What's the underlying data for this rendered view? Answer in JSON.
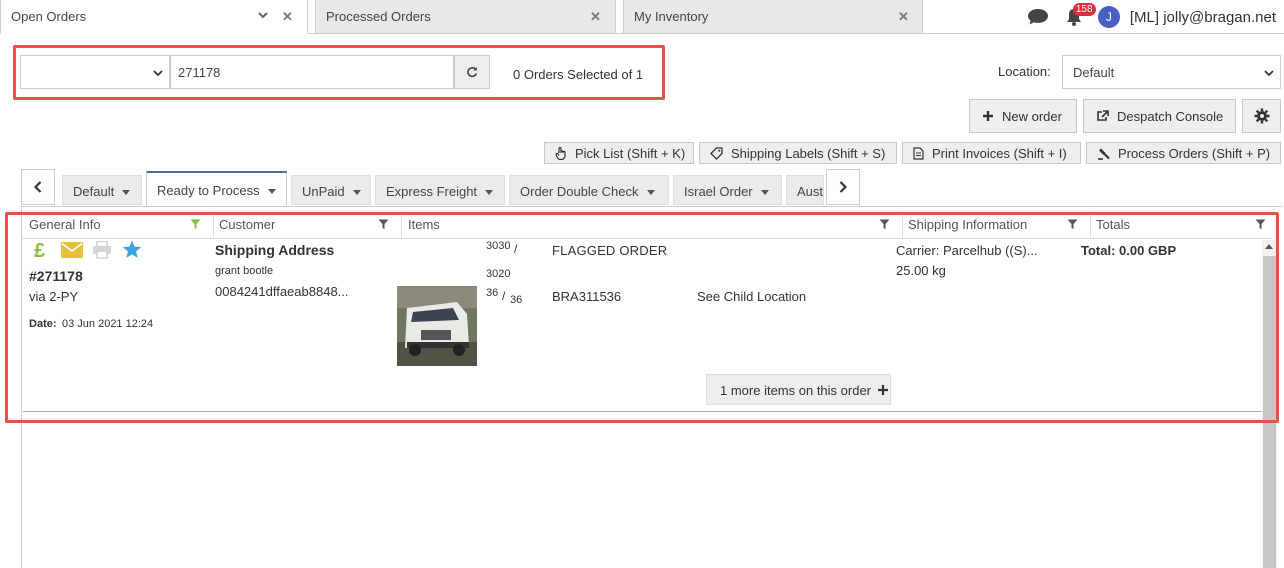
{
  "tabs": [
    {
      "label": "Open Orders",
      "active": true
    },
    {
      "label": "Processed Orders",
      "active": false
    },
    {
      "label": "My Inventory",
      "active": false
    }
  ],
  "header": {
    "notification_count": "158",
    "avatar_letter": "J",
    "user": "[ML] jolly@bragan.net"
  },
  "search": {
    "field_value": "",
    "query": "271178",
    "selected_text": "0 Orders Selected of 1"
  },
  "location": {
    "label": "Location:",
    "value": "Default"
  },
  "actions": {
    "new_order": "New order",
    "despatch_console": "Despatch Console"
  },
  "toolbar": {
    "pick_list": "Pick List (Shift + K)",
    "shipping_labels": "Shipping Labels (Shift + S)",
    "print_invoices": "Print Invoices (Shift + I)",
    "process_orders": "Process Orders (Shift + P)"
  },
  "filter_tabs": [
    {
      "label": "Default",
      "active": false
    },
    {
      "label": "Ready to Process",
      "active": true
    },
    {
      "label": "UnPaid",
      "active": false
    },
    {
      "label": "Express Freight",
      "active": false
    },
    {
      "label": "Order Double Check",
      "active": false
    },
    {
      "label": "Israel Order",
      "active": false
    },
    {
      "label": "Aust",
      "active": false
    }
  ],
  "columns": {
    "general_info": "General Info",
    "customer": "Customer",
    "items": "Items",
    "shipping_information": "Shipping Information",
    "totals": "Totals"
  },
  "order": {
    "currency_symbol": "£",
    "id": "#271178",
    "via": "via 2-PY",
    "date_label": "Date:",
    "date": "03 Jun 2021 12:24",
    "customer_heading": "Shipping Address",
    "customer_name": "grant bootle",
    "customer_ref": "0084241dffaeab8848...",
    "item_qty_top": "3030",
    "item_qty_slash": "/",
    "item_qty_mid": "3020",
    "item_qty_a": "36",
    "item_qty_b": "36",
    "item_flag": "FLAGGED ORDER",
    "item_sku": "BRA311536",
    "item_location": "See Child Location",
    "carrier": "Carrier: Parcelhub ((S)...",
    "weight": "25.00 kg",
    "total": "Total: 0.00 GBP",
    "more_items": "1 more items on this order"
  },
  "colors": {
    "highlight": "#e05546",
    "pound_green": "#8bbf43",
    "mail_yellow": "#e8c23a",
    "star_blue": "#3fa3e6",
    "badge_red": "#d9303b",
    "avatar_blue": "#4a5fc1"
  }
}
